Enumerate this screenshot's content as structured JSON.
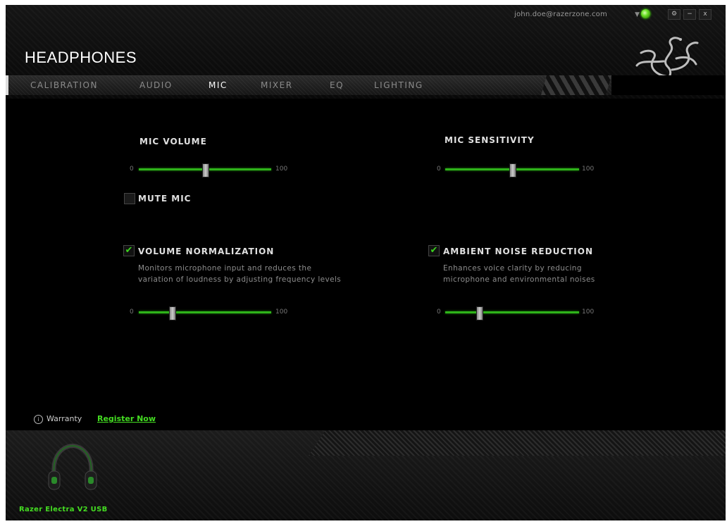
{
  "header": {
    "account": "john.doe@razerzone.com",
    "title": "HEADPHONES",
    "window_controls": [
      "⚙",
      "−",
      "x"
    ]
  },
  "tabs": [
    {
      "label": "CALIBRATION",
      "active": false
    },
    {
      "label": "AUDIO",
      "active": false
    },
    {
      "label": "MIC",
      "active": true
    },
    {
      "label": "MIXER",
      "active": false
    },
    {
      "label": "EQ",
      "active": false
    },
    {
      "label": "LIGHTING",
      "active": false
    }
  ],
  "mic_volume": {
    "label": "MIC VOLUME",
    "min": "0",
    "max": "100",
    "value": 50
  },
  "mute_mic": {
    "label": "MUTE MIC",
    "checked": false
  },
  "mic_sensitivity": {
    "label": "MIC SENSITIVITY",
    "min": "0",
    "max": "100",
    "value": 50
  },
  "volume_normalization": {
    "label": "VOLUME NORMALIZATION",
    "checked": true,
    "description": "Monitors microphone input and reduces the variation of loudness by adjusting frequency levels",
    "min": "0",
    "max": "100",
    "value": 25
  },
  "ambient_noise_reduction": {
    "label": "AMBIENT NOISE REDUCTION",
    "checked": true,
    "description": "Enhances voice clarity by reducing microphone and environmental noises",
    "min": "0",
    "max": "100",
    "value": 25
  },
  "footer": {
    "warranty_label": "Warranty",
    "register_link": "Register Now",
    "device_name": "Razer Electra V2 USB"
  },
  "colors": {
    "accent": "#44dd22",
    "slider": "#2fb31a"
  },
  "icons": [
    "status-dot-icon",
    "gear-icon",
    "minimize-icon",
    "close-icon",
    "razer-logo-icon",
    "info-icon",
    "checkmark-icon",
    "headset-icon"
  ]
}
